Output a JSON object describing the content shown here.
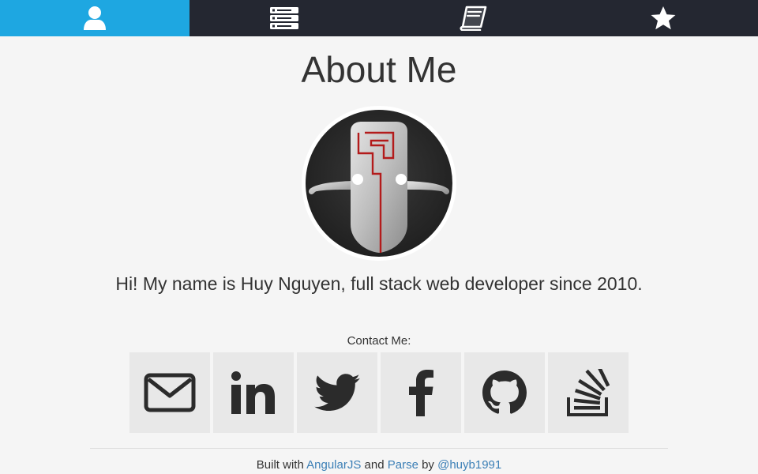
{
  "nav": {
    "tabs": [
      {
        "icon": "user-icon",
        "active": true
      },
      {
        "icon": "server-icon",
        "active": false
      },
      {
        "icon": "book-icon",
        "active": false
      },
      {
        "icon": "star-icon",
        "active": false
      }
    ],
    "active_color": "#1ea7e1",
    "bar_color": "#242731"
  },
  "main": {
    "title": "About Me",
    "avatar_icon": "totem-mask-icon",
    "intro": "Hi! My name is Huy Nguyen, full stack web developer since 2010.",
    "contact_label": "Contact Me:",
    "social": [
      {
        "icon": "envelope-icon"
      },
      {
        "icon": "linkedin-icon"
      },
      {
        "icon": "twitter-icon"
      },
      {
        "icon": "facebook-icon"
      },
      {
        "icon": "github-icon"
      },
      {
        "icon": "stackoverflow-icon"
      }
    ]
  },
  "footer": {
    "prefix": "Built with ",
    "link1": "AngularJS",
    "mid": " and ",
    "link2": "Parse",
    "by": " by ",
    "link3": "@huyb1991",
    "link_color": "#3b7fb6"
  }
}
